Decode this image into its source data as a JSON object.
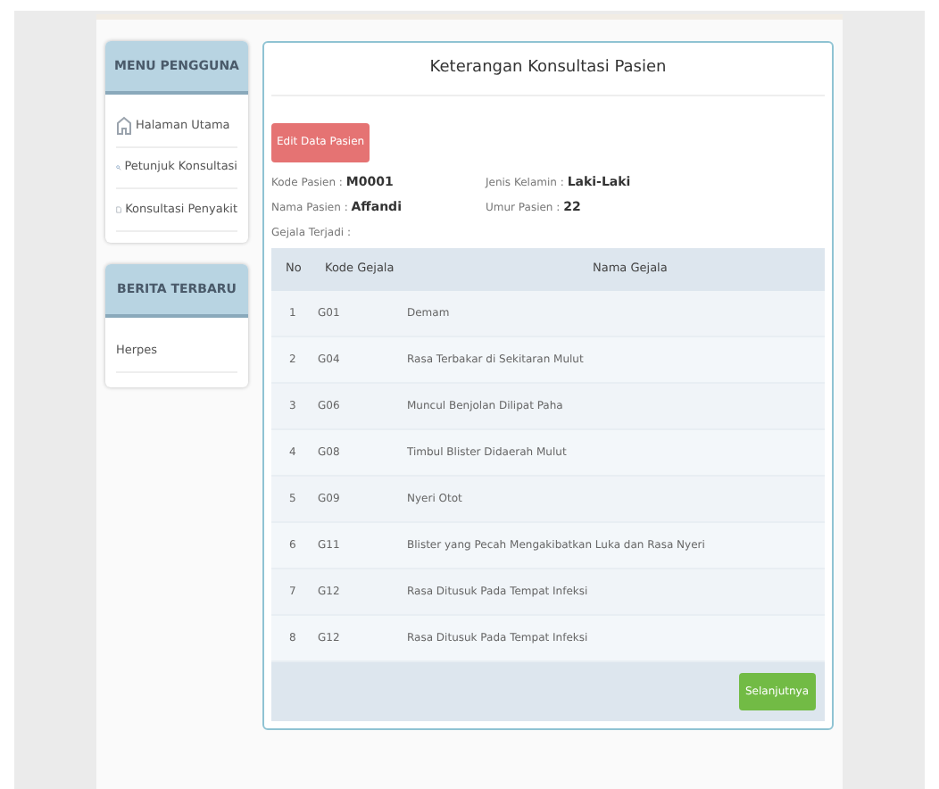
{
  "sidebar": {
    "menu": {
      "title": "MENU PENGGUNA",
      "items": [
        {
          "kind": "home",
          "label": "Halaman Utama"
        },
        {
          "kind": "search",
          "label": "Petunjuk Konsultasi"
        },
        {
          "kind": "document",
          "label": "Konsultasi Penyakit"
        }
      ]
    },
    "news": {
      "title": "BERITA TERBARU",
      "items": [
        "Herpes"
      ]
    }
  },
  "panel": {
    "title": "Keterangan Konsultasi Pasien",
    "edit_button": "Edit Data Pasien",
    "fields": [
      {
        "label": "Kode Pasien :",
        "value": "M0001"
      },
      {
        "label": "Jenis Kelamin :",
        "value": "Laki-Laki"
      },
      {
        "label": "Nama Pasien :",
        "value": "Affandi"
      },
      {
        "label": "Umur Pasien :",
        "value": "22"
      }
    ],
    "symptoms_label": "Gejala Terjadi :",
    "table": {
      "columns": [
        "No",
        "Kode Gejala",
        "Nama Gejala"
      ],
      "rows": [
        [
          "1",
          "G01",
          "Demam"
        ],
        [
          "2",
          "G04",
          "Rasa Terbakar di Sekitaran Mulut"
        ],
        [
          "3",
          "G06",
          "Muncul Benjolan Dilipat Paha"
        ],
        [
          "4",
          "G08",
          "Timbul Blister Didaerah Mulut"
        ],
        [
          "5",
          "G09",
          "Nyeri Otot"
        ],
        [
          "6",
          "G11",
          "Blister yang Pecah Mengakibatkan Luka dan Rasa Nyeri"
        ],
        [
          "7",
          "G12",
          "Rasa Ditusuk Pada Tempat Infeksi"
        ],
        [
          "8",
          "G12",
          "Rasa Ditusuk Pada Tempat Infeksi"
        ]
      ]
    },
    "next_button": "Selanjutnya"
  }
}
